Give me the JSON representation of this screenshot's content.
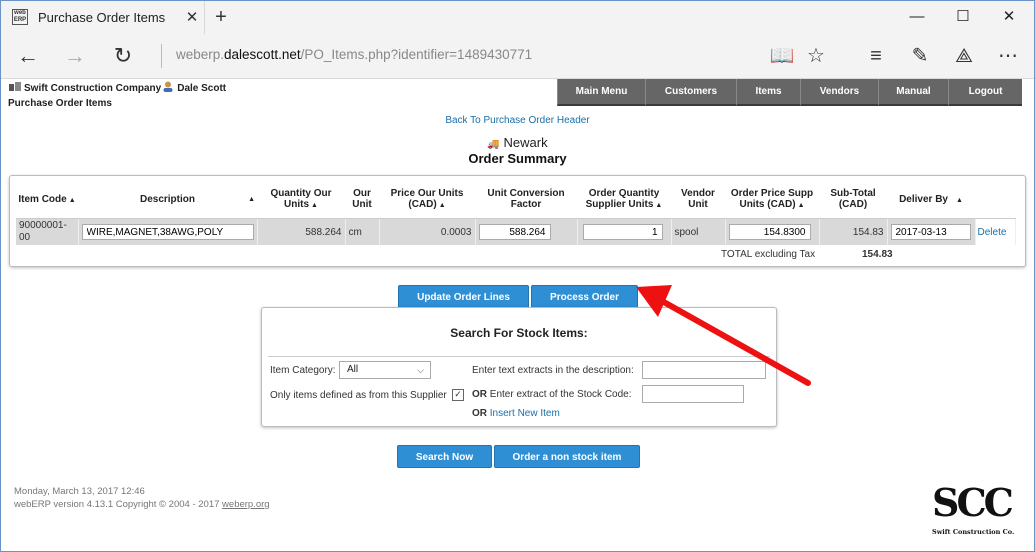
{
  "browser": {
    "tab_title": "Purchase Order Items",
    "favicon_text": "web ERP",
    "url_prefix": "weberp.",
    "url_host": "dalescott.net",
    "url_path": "/PO_Items.php?identifier=1489430771"
  },
  "header": {
    "company": "Swift Construction Company",
    "user": "Dale Scott",
    "page_title": "Purchase Order Items"
  },
  "menu": [
    "Main Menu",
    "Customers",
    "Items",
    "Vendors",
    "Manual",
    "Logout"
  ],
  "back_link": "Back To Purchase Order Header",
  "location": "Newark",
  "summary_title": "Order Summary",
  "table": {
    "headers": {
      "item_code": "Item Code",
      "description": "Description",
      "qty_our_units": "Quantity Our Units",
      "our_unit": "Our Unit",
      "price_our_units": "Price Our Units (CAD)",
      "unit_conversion": "Unit Conversion Factor",
      "order_qty_supplier": "Order Quantity Supplier Units",
      "vendor_unit": "Vendor Unit",
      "order_price_supp": "Order Price Supp Units (CAD)",
      "subtotal": "Sub-Total (CAD)",
      "deliver_by": "Deliver By"
    },
    "row": {
      "item_code": "90000001-00",
      "description": "WIRE,MAGNET,38AWG,POLY",
      "qty_our_units": "588.264",
      "our_unit": "cm",
      "price_our_units": "0.0003",
      "unit_conversion": "588.264",
      "order_qty_supplier": "1",
      "vendor_unit": "spool",
      "order_price_supp": "154.8300",
      "subtotal": "154.83",
      "deliver_by": "2017-03-13",
      "delete": "Delete"
    },
    "total_label": "TOTAL excluding Tax",
    "total_value": "154.83"
  },
  "buttons": {
    "update": "Update Order Lines",
    "process": "Process Order",
    "search_now": "Search Now",
    "non_stock": "Order a non stock item"
  },
  "search": {
    "title": "Search For Stock Items:",
    "category_label": "Item Category:",
    "category_value": "All",
    "supplier_only_label": "Only items defined as from this Supplier",
    "desc_label": "Enter text extracts in the description:",
    "or1": "OR",
    "code_label": "Enter extract of the Stock Code:",
    "or2": "OR",
    "insert_link": "Insert New Item"
  },
  "footer": {
    "date": "Monday, March 13, 2017 12:46",
    "version": "webERP version 4.13.1 Copyright © 2004 - 2017",
    "site": "weberp.org"
  },
  "logo": {
    "letters": "SCC",
    "name": "Swift Construction Co."
  },
  "colors": {
    "button_blue": "#2e8fd4",
    "menu_gray": "#666666",
    "link_blue": "#1a6fa8",
    "annotation_red": "#ee1111"
  }
}
